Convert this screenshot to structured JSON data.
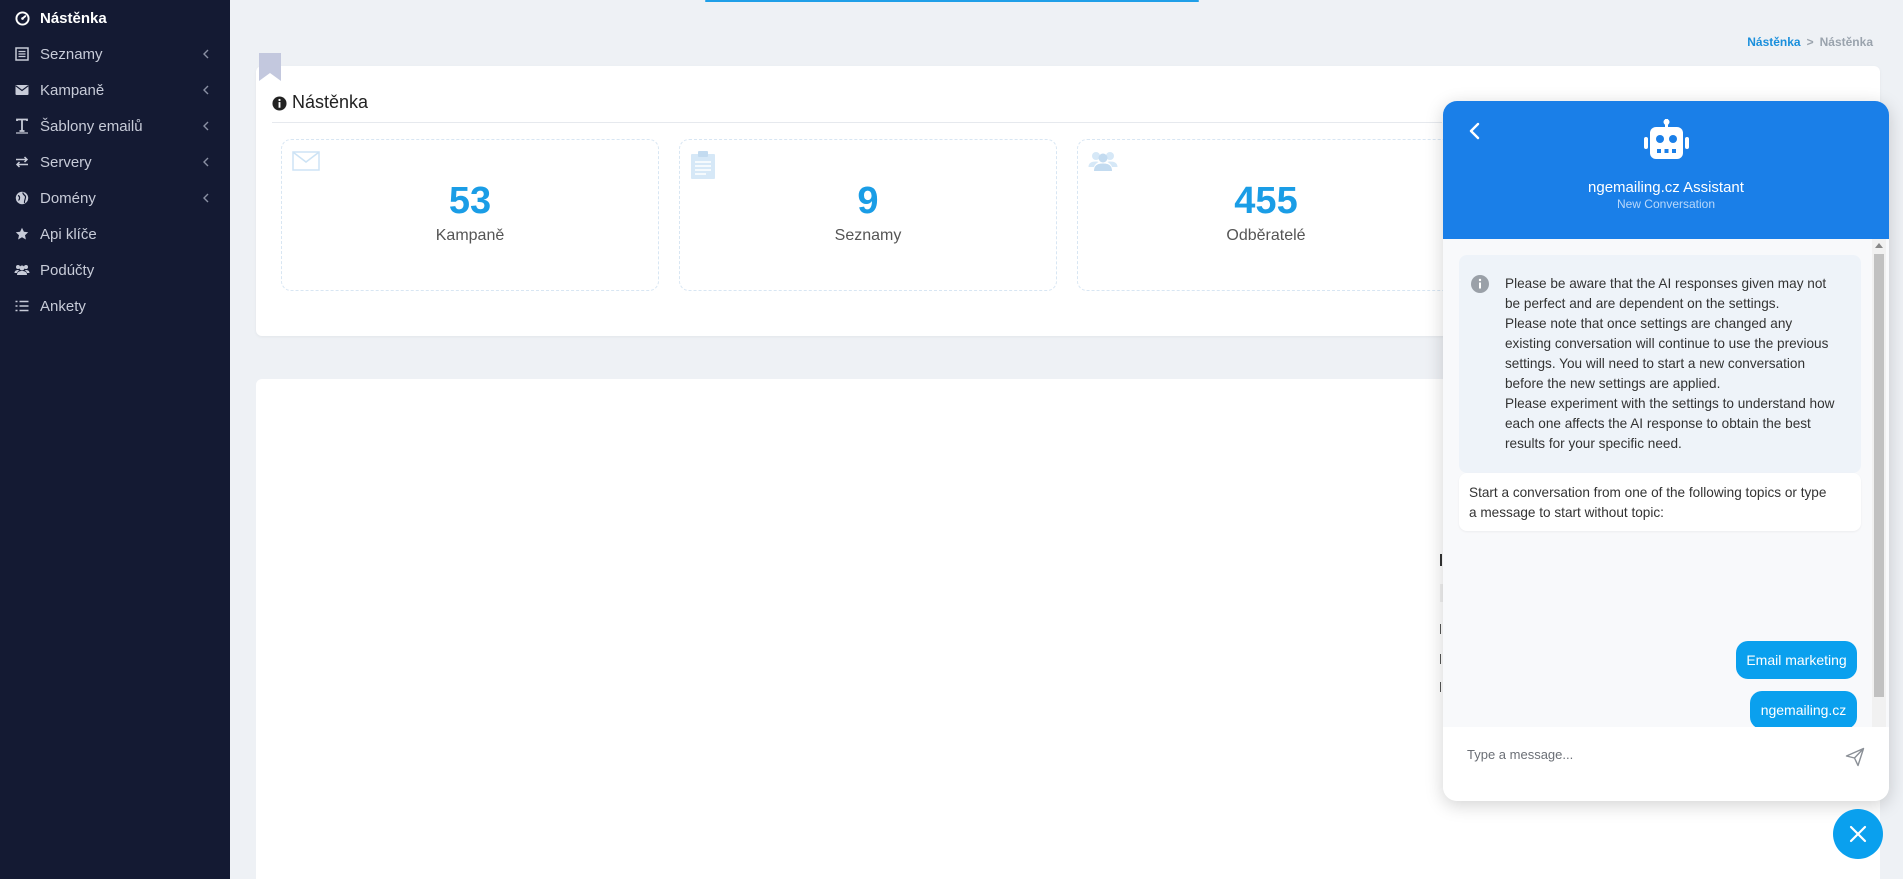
{
  "sidebar": {
    "items": [
      {
        "label": "Nástěnka",
        "icon": "dashboard-icon",
        "active": true
      },
      {
        "label": "Seznamy",
        "icon": "list-icon",
        "has_children": true
      },
      {
        "label": "Kampaně",
        "icon": "envelope-icon",
        "has_children": true
      },
      {
        "label": "Šablony emailů",
        "icon": "text-icon",
        "has_children": true
      },
      {
        "label": "Servery",
        "icon": "exchange-icon",
        "has_children": true
      },
      {
        "label": "Domény",
        "icon": "globe-icon",
        "has_children": true
      },
      {
        "label": "Api klíče",
        "icon": "star-icon"
      },
      {
        "label": "Podúčty",
        "icon": "users-icon"
      },
      {
        "label": "Ankety",
        "icon": "list-icon"
      }
    ]
  },
  "breadcrumb": {
    "link": "Nástěnka",
    "separator": ">",
    "current": "Nástěnka"
  },
  "dashboard": {
    "title": "Nástěnka",
    "stats": [
      {
        "value": "53",
        "label": "Kampaně",
        "icon": "envelope-icon"
      },
      {
        "value": "9",
        "label": "Seznamy",
        "icon": "clipboard-icon"
      },
      {
        "value": "455",
        "label": "Odběratelé",
        "icon": "users-icon"
      }
    ]
  },
  "colors": {
    "sidebar_bg": "#141a33",
    "accent": "#1a9de6",
    "chat_header": "#1a7fe8",
    "topic_button": "#0aa0ee"
  },
  "chat": {
    "title": "ngemailing.cz Assistant",
    "subtitle": "New Conversation",
    "notice": "Please be aware that the AI responses given may not be perfect and are dependent on the settings. Please note that once settings are changed any existing conversation will continue to use the previous settings. You will need to start a new conversation before the new settings are applied. Please experiment with the settings to understand how each one affects the AI response to obtain the best results for your specific need.",
    "notice_lines": [
      "Please be aware that the AI responses given may not",
      "be perfect and are dependent on the settings.",
      "Please note that once settings are changed any",
      "existing conversation will continue to use the previous",
      "settings. You will need to start a new conversation",
      "before the new settings are applied.",
      "Please experiment with the settings to understand how",
      "each one affects the AI response to obtain the best",
      "results for your specific need."
    ],
    "bot_message_lines": [
      "Start a conversation from one of the following topics or type",
      "a message to start without topic:"
    ],
    "topics": [
      "Email marketing",
      "ngemailing.cz"
    ],
    "input_placeholder": "Type a message..."
  }
}
